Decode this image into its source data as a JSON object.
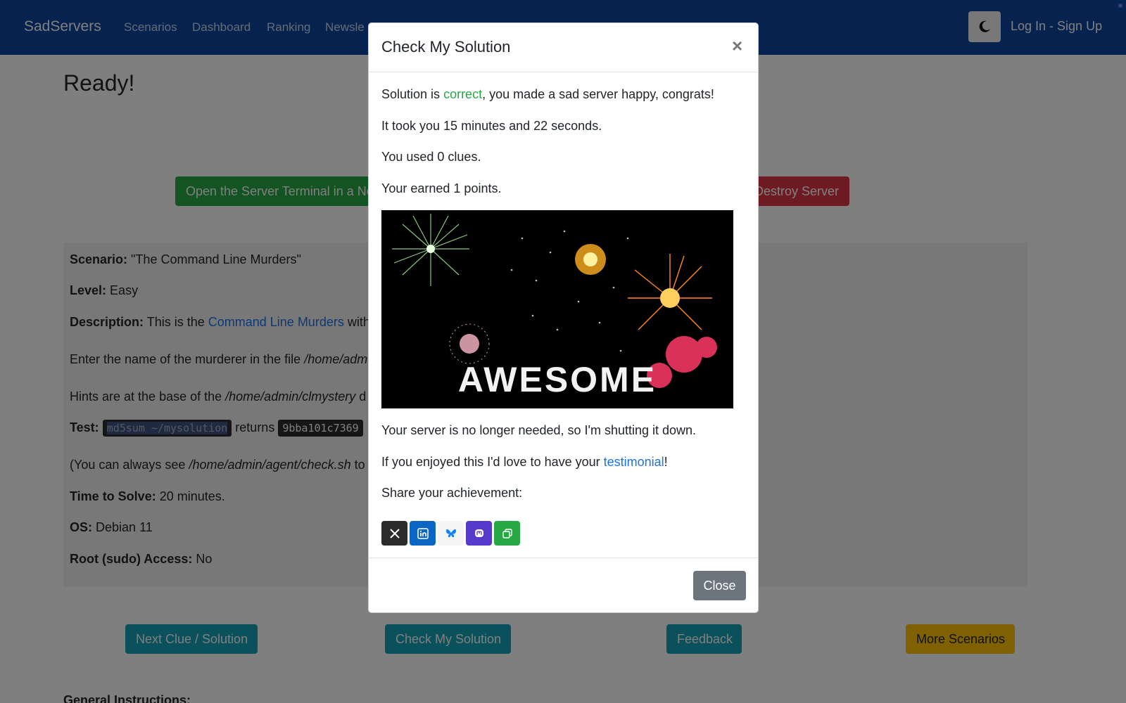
{
  "nav": {
    "brand": "SadServers",
    "links": [
      "Scenarios",
      "Dashboard",
      "Ranking",
      "Newsle"
    ],
    "login": "Log In - Sign Up"
  },
  "page": {
    "title": "Ready!",
    "open_terminal_button": "Open the Server Terminal in a New Tab",
    "destroy_button": "Destroy Server",
    "scenario_label": "Scenario:",
    "scenario_value": "\"The Command Line Murders\"",
    "level_label": "Level:",
    "level_value": "Easy",
    "description_label": "Description:",
    "description_pre": "This is the",
    "description_link": "Command Line Murders",
    "description_post": "with",
    "enter_name_pre": "Enter the name of the murderer in the file",
    "enter_name_path": "/home/adm",
    "hints_pre": "Hints are at the base of the",
    "hints_path": "/home/admin/clmystery",
    "hints_post": "d",
    "test_label": "Test:",
    "test_command": "md5sum ~/mysolution",
    "test_returns": "returns",
    "test_hash": "9bba101c7369",
    "check_pre": "(You can always see",
    "check_path": "/home/admin/agent/check.sh",
    "check_post": "to",
    "time_label": "Time to Solve:",
    "time_value": "20 minutes.",
    "os_label": "OS:",
    "os_value": "Debian 11",
    "root_label": "Root (sudo) Access:",
    "root_value": "No",
    "next_clue_button": "Next Clue / Solution",
    "check_solution_button": "Check My Solution",
    "feedback_button": "Feedback",
    "more_scenarios_button": "More Scenarios",
    "general_instructions": "General Instructions:"
  },
  "modal": {
    "title": "Check My Solution",
    "close_x": "×",
    "solution_pre": "Solution is ",
    "solution_word": "correct",
    "solution_post": ", you made a sad server happy, congrats!",
    "took": "It took you 15 minutes and 22 seconds.",
    "clues": "You used 0 clues.",
    "points": "Your earned 1 points.",
    "image_text": "AWESOME",
    "shutdown": "Your server is no longer needed, so I'm shutting it down.",
    "testimonial_pre": "If you enjoyed this I'd love to have your ",
    "testimonial_link": "testimonial",
    "testimonial_post": "!",
    "share_label": "Share your achievement:",
    "share_icons": [
      "x-icon",
      "linkedin-icon",
      "bluesky-icon",
      "mastodon-icon",
      "copy-icon"
    ],
    "close_button": "Close"
  },
  "colors": {
    "navbar": "#0d47a1",
    "green": "#28a745",
    "red": "#dc3545",
    "teal": "#17a2b8",
    "yellow": "#ffc107",
    "gray": "#6c757d"
  }
}
